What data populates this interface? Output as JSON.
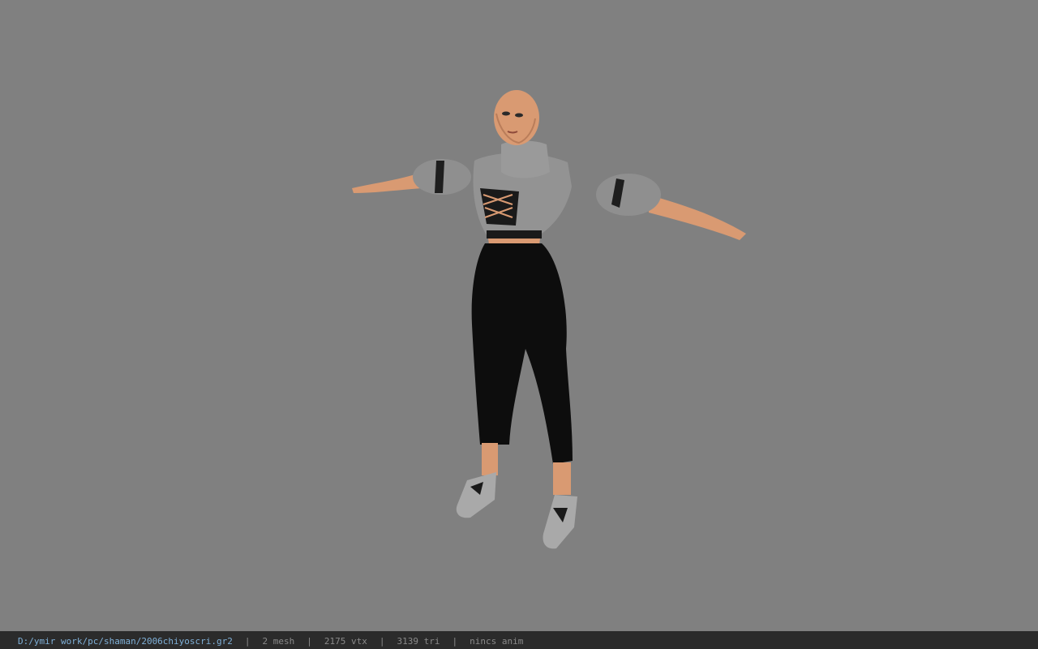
{
  "viewport": {
    "background": "#808080",
    "model_name": "3d-character-model"
  },
  "status": {
    "file_path": "D:/ymir work/pc/shaman/2006chiyoscri.gr2",
    "separator": "|",
    "mesh": "2 mesh",
    "vertices": "2175 vtx",
    "triangles": "3139 tri",
    "anim": "nincs anim"
  }
}
